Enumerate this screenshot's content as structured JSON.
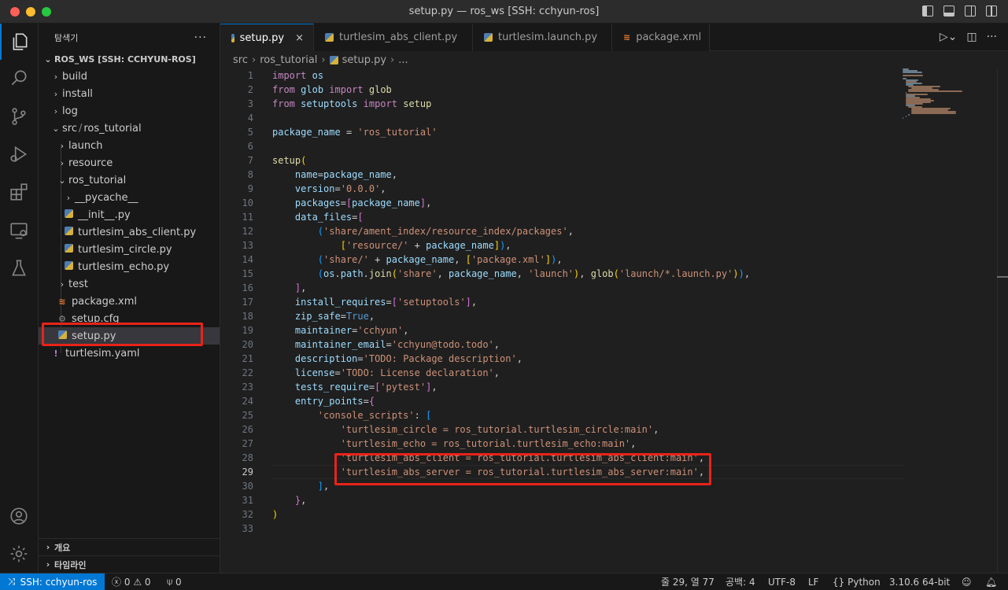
{
  "window": {
    "title": "setup.py — ros_ws [SSH: cchyun-ros]"
  },
  "activity_bar": [
    "files-icon",
    "search-icon",
    "source-control-icon",
    "run-debug-icon",
    "extensions-icon",
    "remote-explorer-icon",
    "testing-icon",
    "account-icon",
    "manage-gear-icon"
  ],
  "sidebar": {
    "title": "탐색기",
    "more": "···",
    "root": "ROS_WS [SSH: CCHYUN-ROS]",
    "items": {
      "build": "build",
      "install": "install",
      "log": "log",
      "src": "src",
      "src_sep": "/",
      "ros_tutorial": "ros_tutorial",
      "launch": "launch",
      "resource": "resource",
      "ros_tutorial_pkg": "ros_tutorial",
      "pycache": "__pycache__",
      "init": "__init__.py",
      "abs_client": "turtlesim_abs_client.py",
      "circle": "turtlesim_circle.py",
      "echo": "turtlesim_echo.py",
      "test": "test",
      "package_xml": "package.xml",
      "setup_cfg": "setup.cfg",
      "setup_py": "setup.py",
      "turtlesim_yaml": "turtlesim.yaml"
    },
    "outline": "개요",
    "timeline": "타임라인"
  },
  "tabs": [
    {
      "label": "setup.py"
    },
    {
      "label": "turtlesim_abs_client.py"
    },
    {
      "label": "turtlesim.launch.py"
    },
    {
      "label": "package.xml"
    }
  ],
  "tab_close": "×",
  "breadcrumb": {
    "src": "src",
    "pkg": "ros_tutorial",
    "file": "setup.py",
    "more": "...",
    "sep": "›"
  },
  "editor": {
    "line_numbers": [
      "1",
      "2",
      "3",
      "4",
      "5",
      "6",
      "7",
      "8",
      "9",
      "10",
      "11",
      "12",
      "13",
      "14",
      "15",
      "16",
      "17",
      "18",
      "19",
      "20",
      "21",
      "22",
      "23",
      "24",
      "25",
      "26",
      "27",
      "28",
      "29",
      "30",
      "31",
      "32",
      "33"
    ],
    "current_line": 29,
    "lines": [
      "import os",
      "from glob import glob",
      "from setuptools import setup",
      "",
      "package_name = 'ros_tutorial'",
      "",
      "setup(",
      "    name=package_name,",
      "    version='0.0.0',",
      "    packages=[package_name],",
      "    data_files=[",
      "        ('share/ament_index/resource_index/packages',",
      "            ['resource/' + package_name]),",
      "        ('share/' + package_name, ['package.xml']),",
      "        (os.path.join('share', package_name, 'launch'), glob('launch/*.launch.py')),",
      "    ],",
      "    install_requires=['setuptools'],",
      "    zip_safe=True,",
      "    maintainer='cchyun',",
      "    maintainer_email='cchyun@todo.todo',",
      "    description='TODO: Package description',",
      "    license='TODO: License declaration',",
      "    tests_require=['pytest'],",
      "    entry_points={",
      "        'console_scripts': [",
      "            'turtlesim_circle = ros_tutorial.turtlesim_circle:main',",
      "            'turtlesim_echo = ros_tutorial.turtlesim_echo:main',",
      "            'turtlesim_abs_client = ros_tutorial.turtlesim_abs_client:main',",
      "            'turtlesim_abs_server = ros_tutorial.turtlesim_abs_server:main',",
      "        ],",
      "    },",
      ")",
      ""
    ]
  },
  "statusbar": {
    "remote": "SSH: cchyun-ros",
    "errors": "0",
    "warnings": "0",
    "ports": "0",
    "position": "줄 29, 열 77",
    "indent": "공백: 4",
    "encoding": "UTF-8",
    "eol": "LF",
    "language": "Python",
    "interpreter": "3.10.6 64-bit"
  },
  "colors": {
    "accent": "#0078d4",
    "highlight_box": "#e8231a"
  }
}
